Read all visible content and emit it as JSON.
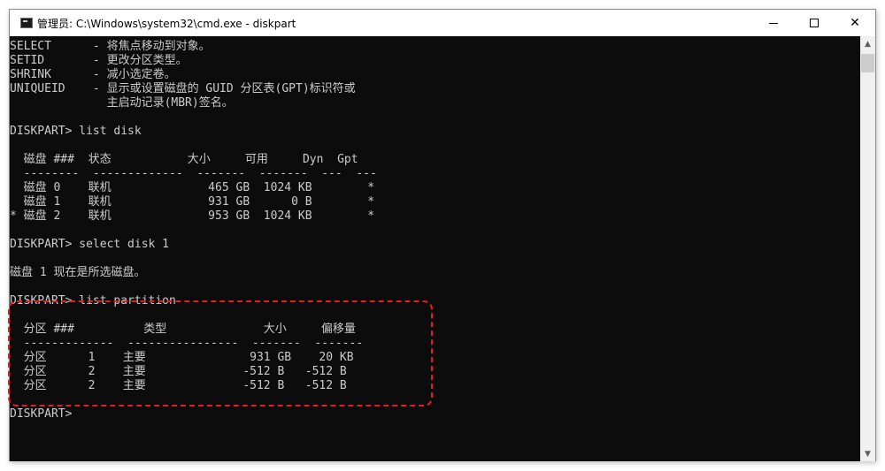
{
  "window": {
    "title": "管理员: C:\\Windows\\system32\\cmd.exe - diskpart",
    "icon": "cmd-icon",
    "controls": {
      "minimize": "minimize-icon",
      "maximize": "maximize-icon",
      "close": "✕"
    }
  },
  "console": {
    "lines": [
      "SELECT      - 将焦点移动到对象。",
      "SETID       - 更改分区类型。",
      "SHRINK      - 减小选定卷。",
      "UNIQUEID    - 显示或设置磁盘的 GUID 分区表(GPT)标识符或",
      "              主启动记录(MBR)签名。",
      "",
      "DISKPART> list disk",
      "",
      "  磁盘 ###  状态           大小     可用     Dyn  Gpt",
      "  --------  -------------  -------  -------  ---  ---",
      "  磁盘 0    联机              465 GB  1024 KB        *",
      "  磁盘 1    联机              931 GB      0 B        *",
      "* 磁盘 2    联机              953 GB  1024 KB        *",
      "",
      "DISKPART> select disk 1",
      "",
      "磁盘 1 现在是所选磁盘。",
      "",
      "DISKPART> list partition",
      "",
      "  分区 ###          类型              大小     偏移量",
      "  -------------  ----------------  -------  -------",
      "  分区      1    主要               931 GB    20 KB",
      "  分区      2    主要              -512 B   -512 B",
      "  分区      2    主要              -512 B   -512 B",
      "",
      "DISKPART> "
    ]
  },
  "scrollbar": {
    "up": "▲",
    "down": "▼"
  },
  "colors": {
    "console_bg": "#0c0c0c",
    "console_text": "#cccccc",
    "highlight": "#e02020"
  }
}
